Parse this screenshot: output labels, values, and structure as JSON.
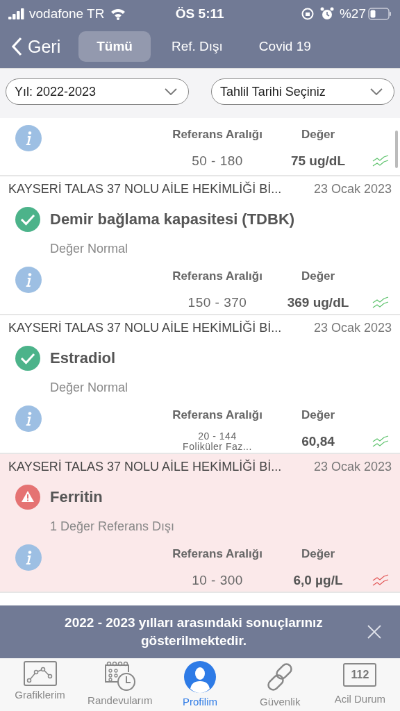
{
  "status_bar": {
    "carrier": "vodafone TR",
    "time": "ÖS 5:11",
    "battery": "%27"
  },
  "nav": {
    "back": "Geri",
    "tabs": [
      {
        "label": "Tümü",
        "selected": true
      },
      {
        "label": "Ref. Dışı",
        "selected": false
      },
      {
        "label": "Covid 19",
        "selected": false
      }
    ]
  },
  "filters": [
    {
      "value": "Yıl: 2022-2023"
    },
    {
      "value": "Tahlil Tarihi Seçiniz"
    }
  ],
  "results": [
    {
      "kind": "normal",
      "ref_label": "Referans Aralığı",
      "value_label": "Değer",
      "range": "50 - 180",
      "value": "75 ug/dL"
    },
    {
      "kind": "normal",
      "source": "KAYSERİ TALAS 37 NOLU AİLE HEKİMLİĞİ Bİ...",
      "date": "23 Ocak 2023",
      "name": "Demir bağlama kapasitesi (TDBK)",
      "summary": "Değer Normal",
      "ref_label": "Referans Aralığı",
      "value_label": "Değer",
      "range": "150 - 370",
      "value": "369 ug/dL"
    },
    {
      "kind": "normal",
      "source": "KAYSERİ TALAS 37 NOLU AİLE HEKİMLİĞİ Bİ...",
      "date": "23 Ocak 2023",
      "name": "Estradiol",
      "summary": "Değer Normal",
      "ref_label": "Referans Aralığı",
      "value_label": "Değer",
      "range": "20 - 144",
      "range_note": "Foliküler Faz...",
      "value": "60,84"
    },
    {
      "kind": "abnormal",
      "source": "KAYSERİ TALAS 37 NOLU AİLE HEKİMLİĞİ Bİ...",
      "date": "23 Ocak 2023",
      "name": "Ferritin",
      "summary": "1 Değer Referans Dışı",
      "ref_label": "Referans Aralığı",
      "value_label": "Değer",
      "range": "10 - 300",
      "value": "6,0 µg/L"
    }
  ],
  "toast": {
    "message": "2022 - 2023 yılları arasındaki sonuçlarınız gösterilmektedir."
  },
  "tab_bar": [
    {
      "kind": "chart",
      "label": "Grafiklerim",
      "selected": false
    },
    {
      "kind": "calendar",
      "label": "Randevularım",
      "selected": false
    },
    {
      "kind": "profile",
      "label": "Profilim",
      "selected": true
    },
    {
      "kind": "link",
      "label": "Güvenlik",
      "selected": false
    },
    {
      "kind": "emergency",
      "label": "Acil Durum",
      "code": "112",
      "selected": false
    }
  ]
}
